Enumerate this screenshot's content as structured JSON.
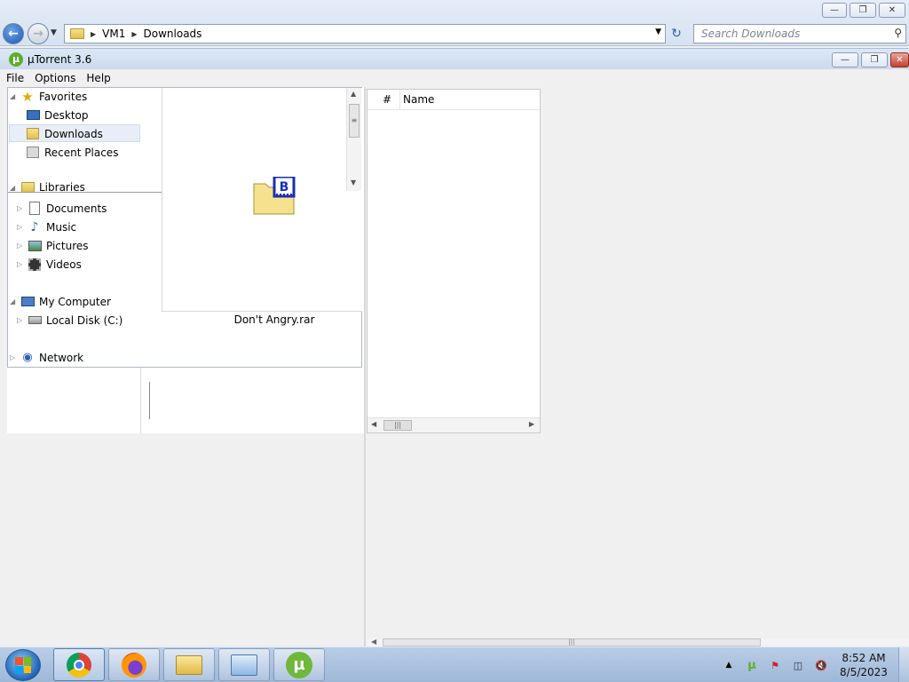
{
  "explorer": {
    "address": {
      "crumbs": [
        "VM1",
        "Downloads"
      ]
    },
    "search": {
      "placeholder": "Search Downloads"
    },
    "window_buttons": {
      "minimize": "—",
      "restore": "❐",
      "close": "✕"
    }
  },
  "utorrent": {
    "title": "µTorrent 3.6",
    "menu": [
      "File",
      "Options",
      "Help"
    ],
    "files_list": {
      "col_number": "#",
      "col_name": "Name"
    }
  },
  "navpane": {
    "favorites": "Favorites",
    "desktop": "Desktop",
    "downloads": "Downloads",
    "recent_places": "Recent Places",
    "libraries": "Libraries",
    "documents": "Documents",
    "music": "Music",
    "pictures": "Pictures",
    "videos": "Videos",
    "my_computer": "My Computer",
    "local_disk": "Local Disk (C:)",
    "network": "Network"
  },
  "preview": {
    "file_name": "Don't Angry.rar"
  },
  "taskbar": {
    "apps": [
      "chrome-icon",
      "firefox-icon",
      "file-explorer-icon",
      "control-panel-icon",
      "utorrent-icon"
    ],
    "clock": {
      "time": "8:52 AM",
      "date": "8/5/2023"
    }
  },
  "colors": {
    "accent": "#1c57b3",
    "utorrent_green": "#5fae2e",
    "selection": "#e8eef7"
  }
}
